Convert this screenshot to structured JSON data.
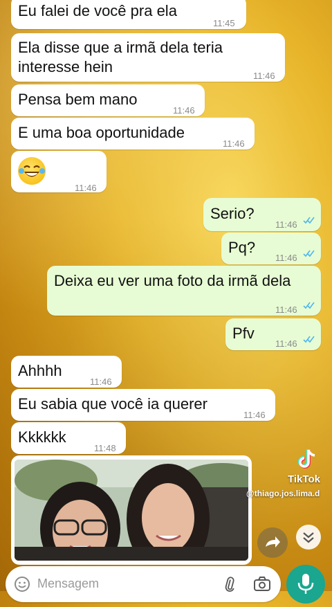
{
  "messages": [
    {
      "text": "Eu falei de você pra ela",
      "time": "11:45"
    },
    {
      "text": "Ela disse que a irmã dela teria\ninteresse hein",
      "time": "11:46"
    },
    {
      "text": "Pensa bem mano",
      "time": "11:46"
    },
    {
      "text": "E uma boa oportunidade",
      "time": "11:46"
    },
    {
      "text": "😂",
      "time": "11:46"
    },
    {
      "text": "Serio?",
      "time": "11:46"
    },
    {
      "text": "Pq?",
      "time": "11:46"
    },
    {
      "text": "Deixa eu ver uma foto da irmã dela",
      "time": "11:46"
    },
    {
      "text": "Pfv",
      "time": "11:46"
    },
    {
      "text": "Ahhhh",
      "time": "11:46"
    },
    {
      "text": "Eu sabia que você ia querer",
      "time": "11:46"
    },
    {
      "text": "Kkkkkk",
      "time": "11:48"
    }
  ],
  "composer": {
    "placeholder": "Mensagem"
  },
  "watermark": {
    "brand": "TikTok",
    "handle": "@thiago.jos.lima.d"
  },
  "icons": [
    "emoji-icon",
    "attach-icon",
    "camera-icon",
    "mic-icon",
    "forward-icon",
    "scroll-down-icon",
    "read-ticks-icon"
  ],
  "colors": {
    "incoming": "#ffffff",
    "outgoing": "#e7fcd4",
    "ticks": "#4fb6ec",
    "mic": "#1aa68f"
  }
}
